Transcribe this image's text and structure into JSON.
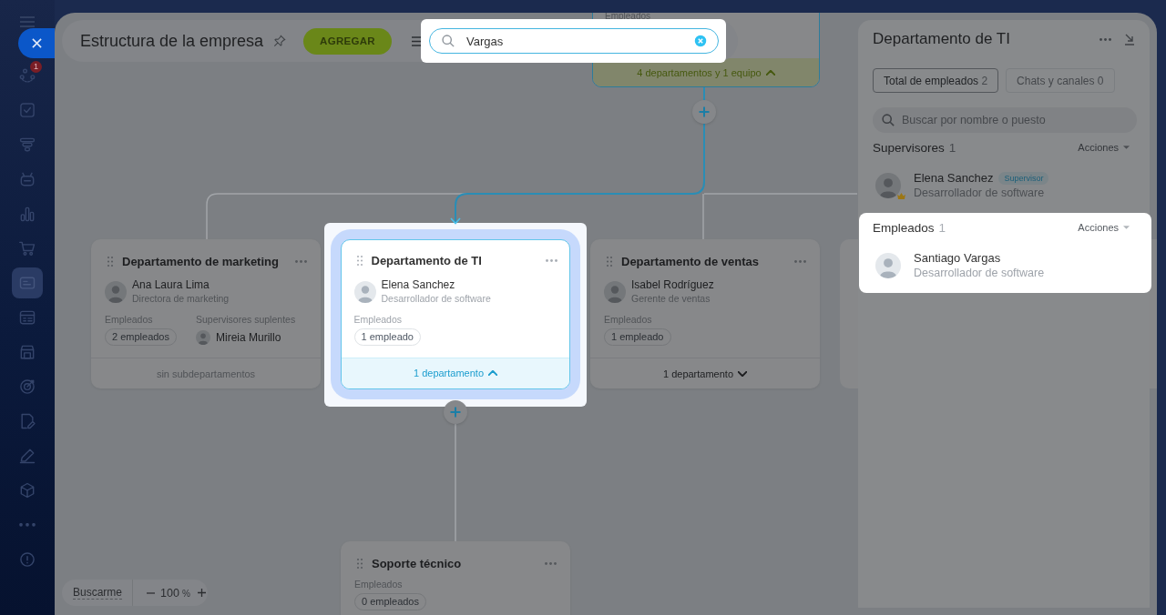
{
  "sidebar": {
    "items": [
      {
        "kind": "activity",
        "selected": false,
        "badge": "1"
      },
      {
        "kind": "tasks",
        "selected": false
      },
      {
        "kind": "funnel",
        "selected": false
      },
      {
        "kind": "robot",
        "selected": false
      },
      {
        "kind": "chart",
        "selected": false
      },
      {
        "kind": "cart",
        "selected": false
      },
      {
        "kind": "card",
        "selected": true
      },
      {
        "kind": "calendar",
        "selected": false
      },
      {
        "kind": "store",
        "selected": false
      },
      {
        "kind": "target",
        "selected": false
      },
      {
        "kind": "document",
        "selected": false
      },
      {
        "kind": "pen",
        "selected": false
      },
      {
        "kind": "cube",
        "selected": false
      },
      {
        "kind": "more",
        "selected": false
      },
      {
        "kind": "circle",
        "selected": false
      }
    ]
  },
  "header": {
    "title": "Estructura de la empresa",
    "add_button": "AGREGAR"
  },
  "search": {
    "value": "Vargas"
  },
  "org_chart": {
    "top_card": {
      "label": "Empleados",
      "footer": "4 departamentos y 1 equipo",
      "expanded": true
    },
    "departments": [
      {
        "title": "Departamento de marketing",
        "highlighted": false,
        "head": {
          "name": "Ana Laura Lima",
          "role": "Directora de marketing"
        },
        "employees_label": "Empleados",
        "employees": "2 empleados",
        "deputies": {
          "label": "Supervisores suplentes",
          "name": "Mireia Murillo"
        },
        "footer": "sin subdepartamentos"
      },
      {
        "title": "Departamento de TI",
        "highlighted": true,
        "head": {
          "name": "Elena Sanchez",
          "role": "Desarrollador de software"
        },
        "employees_label": "Empleados",
        "employees": "1 empleado",
        "footer": "1 departamento",
        "expanded": true
      },
      {
        "title": "Departamento de ventas",
        "highlighted": false,
        "head": {
          "name": "Isabel Rodríguez",
          "role": "Gerente de ventas"
        },
        "employees_label": "Empleados",
        "employees": "1 empleado",
        "footer": "1 departamento",
        "expanded": false
      },
      {
        "title": "Soporte técnico",
        "highlighted": false,
        "employees_label": "Empleados",
        "employees": "0 empleados"
      }
    ]
  },
  "panel": {
    "title": "Departamento de TI",
    "tabs": [
      {
        "label": "Total de empleados",
        "count": "2",
        "selected": true
      },
      {
        "label": "Chats y canales",
        "count": "0",
        "selected": false
      }
    ],
    "search": {
      "placeholder": "Buscar por nombre o puesto"
    },
    "sections": [
      {
        "title": "Supervisores",
        "count": "1",
        "actions": "Acciones",
        "highlighted": false,
        "people": [
          {
            "name": "Elena Sanchez",
            "role": "Desarrollador de software",
            "badge": "Supervisor",
            "crown": true
          }
        ]
      },
      {
        "title": "Empleados",
        "count": "1",
        "actions": "Acciones",
        "highlighted": true,
        "people": [
          {
            "name": "Santiago Vargas",
            "role": "Desarrollador de software",
            "crown": false
          }
        ]
      }
    ]
  },
  "zoom": {
    "locate": "Buscarme",
    "value": "100",
    "unit": "%"
  }
}
